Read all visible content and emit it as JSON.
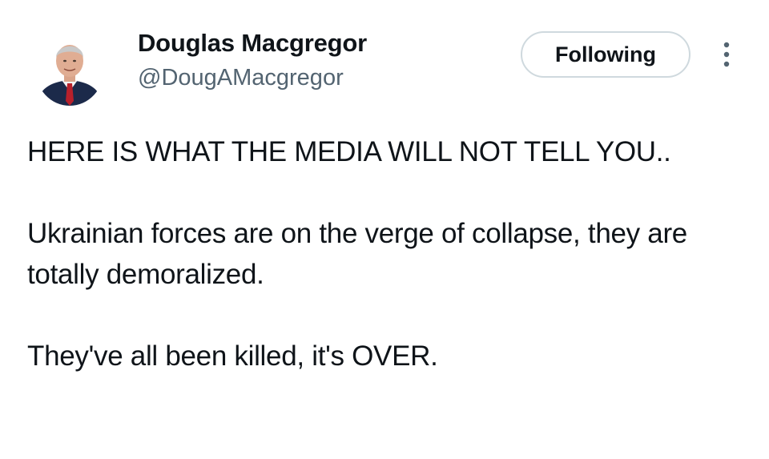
{
  "author": {
    "display_name": "Douglas Macgregor",
    "handle": "@DougAMacgregor"
  },
  "actions": {
    "follow_label": "Following",
    "more_icon": "more-vertical-icon"
  },
  "tweet": {
    "paragraphs": [
      "HERE IS WHAT THE MEDIA WILL NOT TELL YOU..",
      "Ukrainian forces are on the verge of collapse, they are totally demoralized.",
      "They've all been killed, it's OVER."
    ]
  },
  "colors": {
    "text_primary": "#0f1419",
    "text_secondary": "#536471",
    "button_border": "#cfd9de",
    "background": "#ffffff"
  }
}
